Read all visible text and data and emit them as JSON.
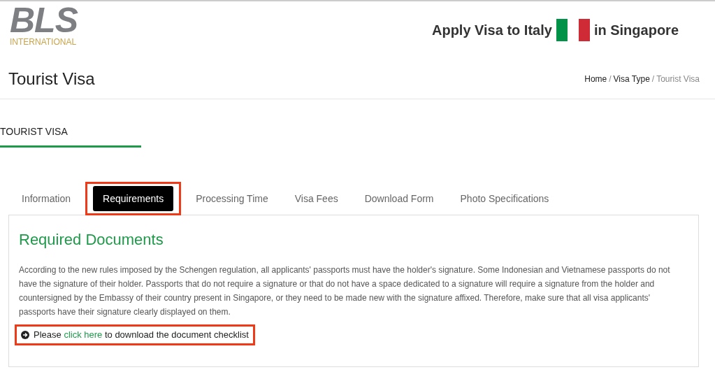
{
  "logo": {
    "mark": "BLS",
    "subtitle": "INTERNATIONAL"
  },
  "header": {
    "title_before": "Apply Visa to Italy",
    "title_after": "in Singapore"
  },
  "page_title": "Tourist Visa",
  "breadcrumb_separator": "/",
  "breadcrumb": [
    {
      "label": "Home",
      "current": false
    },
    {
      "label": "Visa Type",
      "current": false
    },
    {
      "label": "Tourist Visa",
      "current": true
    }
  ],
  "section_tab": {
    "label": "TOURIST VISA",
    "selected": true
  },
  "tabs": [
    {
      "label": "Information",
      "selected": false,
      "highlighted": false
    },
    {
      "label": "Requirements",
      "selected": true,
      "highlighted": true
    },
    {
      "label": "Processing Time",
      "selected": false,
      "highlighted": false
    },
    {
      "label": "Visa Fees",
      "selected": false,
      "highlighted": false
    },
    {
      "label": "Download Form",
      "selected": false,
      "highlighted": false
    },
    {
      "label": "Photo Specifications",
      "selected": false,
      "highlighted": false
    }
  ],
  "panel": {
    "heading": "Required Documents",
    "paragraph": "According to the new rules imposed by the Schengen regulation, all applicants' passports must have the holder's signature. Some Indonesian and Vietnamese passports do not have the signature of their holder. Passports that do not require a signature or that do not have a space dedicated to a signature will require a signature from the holder and countersigned by the Embassy of their country present in Singapore, or they need to be made new with the signature affixed. Therefore, make sure that all visa applicants' passports have their signature clearly displayed on them.",
    "checklist": {
      "before": "Please",
      "link": "click here",
      "after": "to download the document checklist",
      "highlighted": true
    }
  }
}
